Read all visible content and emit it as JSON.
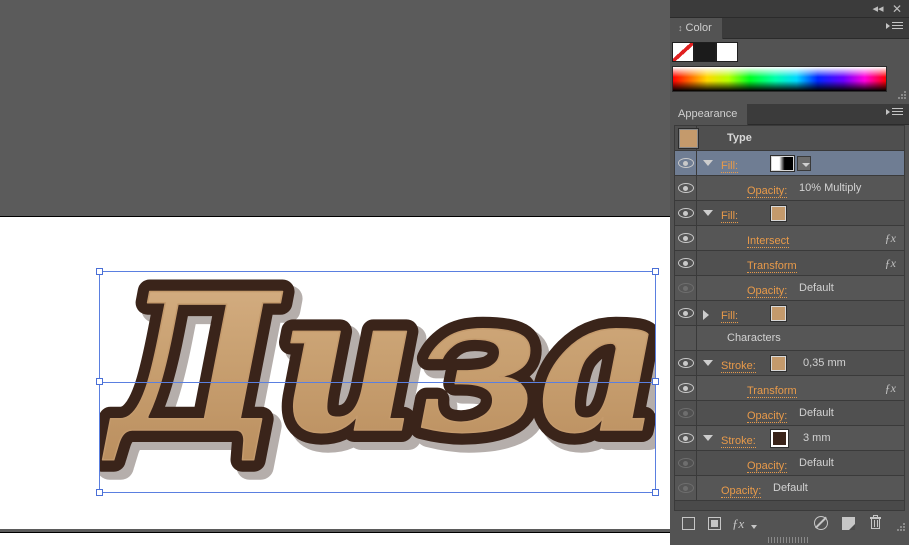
{
  "window": {
    "collapse_icon": "double-left-arrow",
    "close_icon": "close-x"
  },
  "color_panel": {
    "tab_label": "Color",
    "tab_arrows_icon": "double-arrow",
    "menu_icon": "panel-menu",
    "swatches": [
      {
        "name": "none-swatch",
        "color": "none"
      },
      {
        "name": "black-swatch",
        "color": "#1b1b1b"
      },
      {
        "name": "white-swatch",
        "color": "#ffffff"
      }
    ],
    "spectrum_label": "color-spectrum-ramp"
  },
  "appearance_panel": {
    "tab_label": "Appearance",
    "menu_icon": "panel-menu",
    "rows": [
      {
        "id": "type-header",
        "kind": "header",
        "label": "Type",
        "thumb_color": "#c49a6c",
        "eye": "none",
        "disclosure": "none",
        "swatch": null,
        "value": "",
        "fx": false,
        "selected": false,
        "indent": 52
      },
      {
        "id": "fill-1",
        "kind": "attribute",
        "label": "Fill:",
        "eye": "on",
        "disclosure": "open",
        "swatch": "gradient-bw",
        "value": "",
        "fx": false,
        "selected": true,
        "indent": 46
      },
      {
        "id": "fill-1-opacity",
        "kind": "opacity",
        "label": "Opacity:",
        "eye": "on",
        "disclosure": "none",
        "swatch": null,
        "value": "10% Multiply",
        "fx": false,
        "selected": false,
        "indent": 72
      },
      {
        "id": "fill-2",
        "kind": "attribute",
        "label": "Fill:",
        "eye": "on",
        "disclosure": "open",
        "swatch": "tan",
        "value": "",
        "fx": false,
        "selected": false,
        "indent": 46
      },
      {
        "id": "fill-2-intersect",
        "kind": "effect",
        "label": "Intersect",
        "eye": "on",
        "disclosure": "none",
        "swatch": null,
        "value": "",
        "fx": true,
        "selected": false,
        "indent": 72
      },
      {
        "id": "fill-2-transform",
        "kind": "effect",
        "label": "Transform",
        "eye": "on",
        "disclosure": "none",
        "swatch": null,
        "value": "",
        "fx": true,
        "selected": false,
        "indent": 72
      },
      {
        "id": "fill-2-opacity",
        "kind": "opacity",
        "label": "Opacity:",
        "eye": "dim",
        "disclosure": "none",
        "swatch": null,
        "value": "Default",
        "fx": false,
        "selected": false,
        "indent": 72
      },
      {
        "id": "fill-3",
        "kind": "attribute",
        "label": "Fill:",
        "eye": "on",
        "disclosure": "closed",
        "swatch": "tan",
        "value": "",
        "fx": false,
        "selected": false,
        "indent": 46
      },
      {
        "id": "characters",
        "kind": "plain",
        "label": "Characters",
        "eye": "none",
        "disclosure": "none",
        "swatch": null,
        "value": "",
        "fx": false,
        "selected": false,
        "indent": 52
      },
      {
        "id": "stroke-1",
        "kind": "attribute",
        "label": "Stroke:",
        "eye": "on",
        "disclosure": "open",
        "swatch": "tan",
        "value": "0,35 mm",
        "fx": false,
        "selected": false,
        "indent": 46
      },
      {
        "id": "stroke-1-transform",
        "kind": "effect",
        "label": "Transform",
        "eye": "on",
        "disclosure": "none",
        "swatch": null,
        "value": "",
        "fx": true,
        "selected": false,
        "indent": 72
      },
      {
        "id": "stroke-1-opacity",
        "kind": "opacity",
        "label": "Opacity:",
        "eye": "dim",
        "disclosure": "none",
        "swatch": null,
        "value": "Default",
        "fx": false,
        "selected": false,
        "indent": 72
      },
      {
        "id": "stroke-2",
        "kind": "attribute",
        "label": "Stroke:",
        "eye": "on",
        "disclosure": "open",
        "swatch": "brown",
        "value": "3 mm",
        "fx": false,
        "selected": false,
        "indent": 46
      },
      {
        "id": "stroke-2-opacity",
        "kind": "opacity",
        "label": "Opacity:",
        "eye": "dim",
        "disclosure": "none",
        "swatch": null,
        "value": "Default",
        "fx": false,
        "selected": false,
        "indent": 72
      },
      {
        "id": "object-opacity",
        "kind": "opacity",
        "label": "Opacity:",
        "eye": "dim",
        "disclosure": "none",
        "swatch": null,
        "value": "Default",
        "fx": false,
        "selected": false,
        "indent": 46
      }
    ],
    "footer_buttons": [
      {
        "name": "add-new-stroke-button",
        "icon": "square-outline"
      },
      {
        "name": "add-new-fill-button",
        "icon": "square-filled"
      },
      {
        "name": "add-new-effect-button",
        "icon": "fx-dropdown"
      },
      {
        "name": "clear-appearance-button",
        "icon": "no-symbol"
      },
      {
        "name": "duplicate-selected-item-button",
        "icon": "duplicate-page"
      },
      {
        "name": "delete-selected-item-button",
        "icon": "trash"
      }
    ]
  },
  "artwork": {
    "text": "Дизайн",
    "fill_color": "#c49a6c",
    "fill_light": "#d9b489",
    "stroke_color": "#3a241a",
    "shadow_color": "#2d1b12"
  },
  "selection": {
    "handle_names": [
      "handle-top-left",
      "handle-top-right",
      "handle-bottom-left",
      "handle-bottom-right",
      "handle-middle-left",
      "handle-middle-right"
    ]
  }
}
